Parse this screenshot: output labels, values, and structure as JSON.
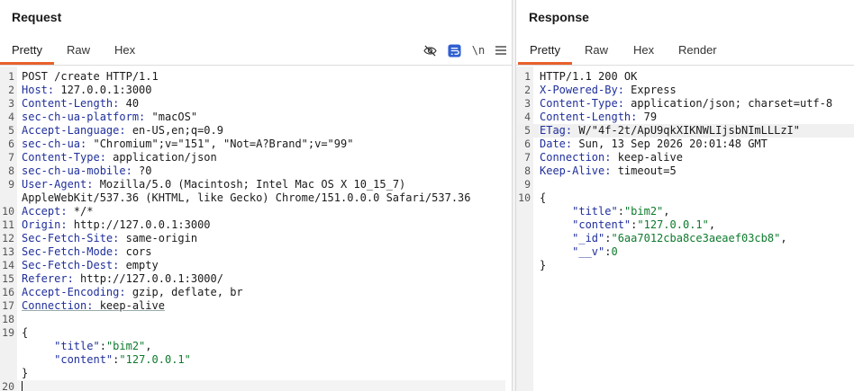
{
  "request": {
    "title": "Request",
    "tabs": [
      "Pretty",
      "Raw",
      "Hex"
    ],
    "toggle_newline_label": "\\n",
    "icons": [
      "eye-off-icon",
      "wrap-icon",
      "newline-toggle",
      "menu-icon"
    ],
    "lines": [
      {
        "n": "1",
        "k": "",
        "v": "POST /create HTTP/1.1"
      },
      {
        "n": "2",
        "k": "Host:",
        "v": " 127.0.0.1:3000"
      },
      {
        "n": "3",
        "k": "Content-Length:",
        "v": " 40"
      },
      {
        "n": "4",
        "k": "sec-ch-ua-platform:",
        "v": " \"macOS\""
      },
      {
        "n": "5",
        "k": "Accept-Language:",
        "v": " en-US,en;q=0.9"
      },
      {
        "n": "6",
        "k": "sec-ch-ua:",
        "v": " \"Chromium\";v=\"151\", \"Not=A?Brand\";v=\"99\""
      },
      {
        "n": "7",
        "k": "Content-Type:",
        "v": " application/json"
      },
      {
        "n": "8",
        "k": "sec-ch-ua-mobile:",
        "v": " ?0"
      },
      {
        "n": "9",
        "k": "User-Agent:",
        "v": " Mozilla/5.0 (Macintosh; Intel Mac OS X 10_15_7)"
      },
      {
        "n": "",
        "k": "",
        "v": "AppleWebKit/537.36 (KHTML, like Gecko) Chrome/151.0.0.0 Safari/537.36"
      },
      {
        "n": "10",
        "k": "Accept:",
        "v": " */*"
      },
      {
        "n": "11",
        "k": "Origin:",
        "v": " http://127.0.0.1:3000"
      },
      {
        "n": "12",
        "k": "Sec-Fetch-Site:",
        "v": " same-origin"
      },
      {
        "n": "13",
        "k": "Sec-Fetch-Mode:",
        "v": " cors"
      },
      {
        "n": "14",
        "k": "Sec-Fetch-Dest:",
        "v": " empty"
      },
      {
        "n": "15",
        "k": "Referer:",
        "v": " http://127.0.0.1:3000/"
      },
      {
        "n": "16",
        "k": "Accept-Encoding:",
        "v": " gzip, deflate, br"
      },
      {
        "n": "17",
        "k": "Connection:",
        "v": " keep-alive"
      },
      {
        "n": "18",
        "k": "",
        "v": ""
      },
      {
        "n": "19",
        "k": "",
        "v": "{"
      },
      {
        "n": "",
        "jk": "\"title\"",
        "jv": "\"bim2\"",
        "tail": ","
      },
      {
        "n": "",
        "jk": "\"content\"",
        "jv": "\"127.0.0.1\"",
        "tail": ""
      },
      {
        "n": "",
        "k": "",
        "v": "}"
      },
      {
        "n": "20",
        "k": "",
        "v": ""
      }
    ]
  },
  "response": {
    "title": "Response",
    "tabs": [
      "Pretty",
      "Raw",
      "Hex",
      "Render"
    ],
    "lines": [
      {
        "n": "1",
        "k": "",
        "v": "HTTP/1.1 200 OK"
      },
      {
        "n": "2",
        "k": "X-Powered-By:",
        "v": " Express"
      },
      {
        "n": "3",
        "k": "Content-Type:",
        "v": " application/json; charset=utf-8"
      },
      {
        "n": "4",
        "k": "Content-Length:",
        "v": " 79"
      },
      {
        "n": "5",
        "k": "ETag:",
        "v": " W/\"4f-2t/ApU9qkXIKNWLIjsbNImLLLzI\""
      },
      {
        "n": "6",
        "k": "Date:",
        "v": " Sun, 13 Sep 2026 20:01:48 GMT"
      },
      {
        "n": "7",
        "k": "Connection:",
        "v": " keep-alive"
      },
      {
        "n": "8",
        "k": "Keep-Alive:",
        "v": " timeout=5"
      },
      {
        "n": "9",
        "k": "",
        "v": ""
      },
      {
        "n": "10",
        "k": "",
        "v": "{"
      },
      {
        "n": "",
        "jk": "\"title\"",
        "jv": "\"bim2\"",
        "tail": ","
      },
      {
        "n": "",
        "jk": "\"content\"",
        "jv": "\"127.0.0.1\"",
        "tail": ","
      },
      {
        "n": "",
        "jk": "\"_id\"",
        "jv": "\"6aa7012cba8ce3aeaef03cb8\"",
        "tail": ","
      },
      {
        "n": "",
        "jk": "\"__v\"",
        "jv": "0",
        "tail": ""
      },
      {
        "n": "",
        "k": "",
        "v": "}"
      }
    ]
  },
  "colors": {
    "accent": "#e8612c",
    "header_key": "#1f2f9b",
    "json_value": "#0d7a2c"
  }
}
